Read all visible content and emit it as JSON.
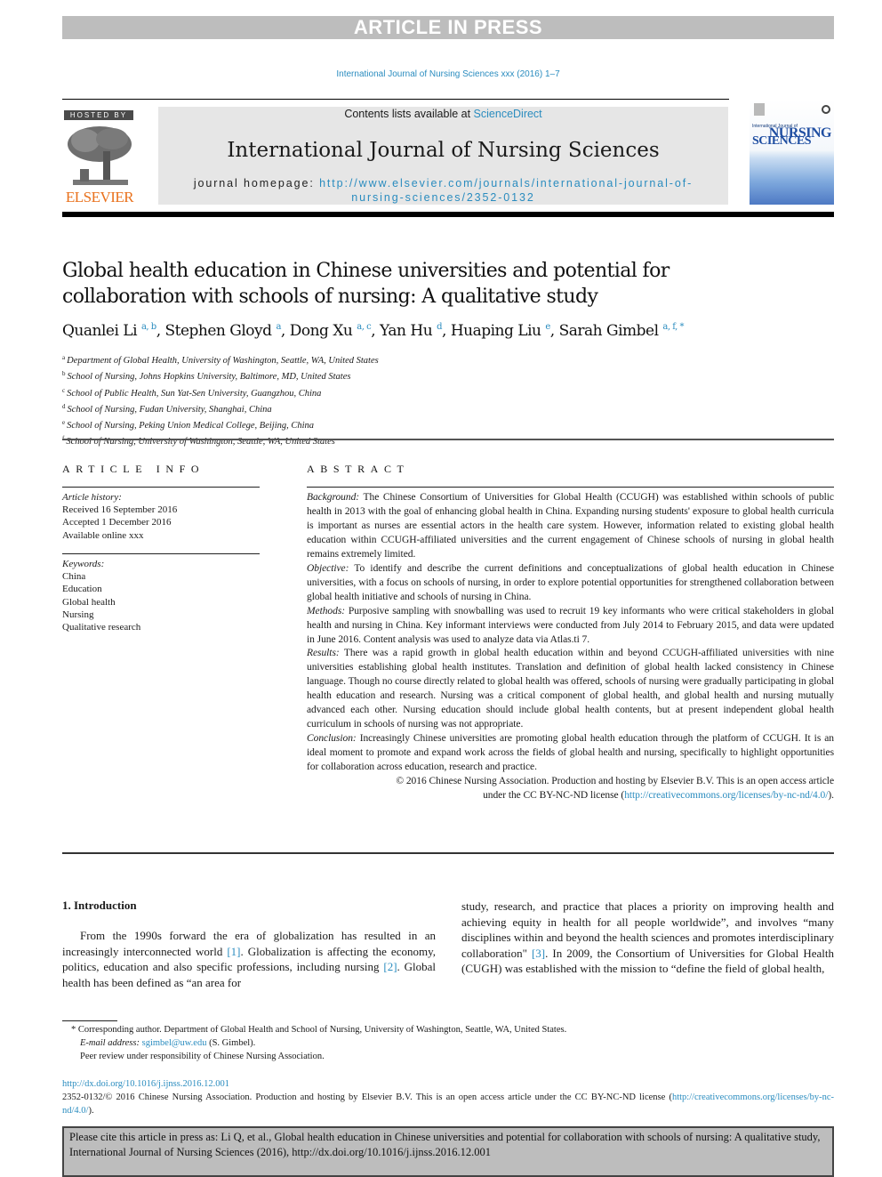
{
  "banner": {
    "text": "ARTICLE IN PRESS"
  },
  "running_head": "International Journal of Nursing Sciences xxx (2016) 1–7",
  "header": {
    "hosted_by": "HOSTED BY",
    "publisher": "ELSEVIER",
    "contents_prefix": "Contents lists available at ",
    "contents_link": "ScienceDirect",
    "journal_name": "International Journal of Nursing Sciences",
    "homepage_label": "journal homepage: ",
    "homepage_url_line1": "http://www.elsevier.com/journals/international-journal-of-",
    "homepage_url_line2": "nursing-sciences/2352-0132",
    "cover": {
      "small_title": "International Journal of",
      "word1": "NURSING",
      "word2": "SCIENCES"
    }
  },
  "article": {
    "title": "Global health education in Chinese universities and potential for collaboration with schools of nursing: A qualitative study",
    "authors": [
      {
        "name": "Quanlei Li",
        "sup": "a, b"
      },
      {
        "name": "Stephen Gloyd",
        "sup": "a"
      },
      {
        "name": "Dong Xu",
        "sup": "a, c"
      },
      {
        "name": "Yan Hu",
        "sup": "d"
      },
      {
        "name": "Huaping Liu",
        "sup": "e"
      },
      {
        "name": "Sarah Gimbel",
        "sup": "a, f, *"
      }
    ],
    "affiliations": [
      {
        "key": "a",
        "text": "Department of Global Health, University of Washington, Seattle, WA, United States"
      },
      {
        "key": "b",
        "text": "School of Nursing, Johns Hopkins University, Baltimore, MD, United States"
      },
      {
        "key": "c",
        "text": "School of Public Health, Sun Yat-Sen University, Guangzhou, China"
      },
      {
        "key": "d",
        "text": "School of Nursing, Fudan University, Shanghai, China"
      },
      {
        "key": "e",
        "text": "School of Nursing, Peking Union Medical College, Beijing, China"
      },
      {
        "key": "f",
        "text": "School of Nursing, University of Washington, Seattle, WA, United States"
      }
    ]
  },
  "article_info": {
    "heading": "ARTICLE INFO",
    "history_label": "Article history:",
    "history": [
      "Received 16 September 2016",
      "Accepted 1 December 2016",
      "Available online xxx"
    ],
    "keywords_label": "Keywords:",
    "keywords": [
      "China",
      "Education",
      "Global health",
      "Nursing",
      "Qualitative research"
    ]
  },
  "abstract": {
    "heading": "ABSTRACT",
    "sections": [
      {
        "label": "Background:",
        "text": "The Chinese Consortium of Universities for Global Health (CCUGH) was established within schools of public health in 2013 with the goal of enhancing global health in China. Expanding nursing students' exposure to global health curricula is important as nurses are essential actors in the health care system. However, information related to existing global health education within CCUGH-affiliated universities and the current engagement of Chinese schools of nursing in global health remains extremely limited."
      },
      {
        "label": "Objective:",
        "text": "To identify and describe the current definitions and conceptualizations of global health education in Chinese universities, with a focus on schools of nursing, in order to explore potential opportunities for strengthened collaboration between global health initiative and schools of nursing in China."
      },
      {
        "label": "Methods:",
        "text": "Purposive sampling with snowballing was used to recruit 19 key informants who were critical stakeholders in global health and nursing in China. Key informant interviews were conducted from July 2014 to February 2015, and data were updated in June 2016. Content analysis was used to analyze data via Atlas.ti 7."
      },
      {
        "label": "Results:",
        "text": "There was a rapid growth in global health education within and beyond CCUGH-affiliated universities with nine universities establishing global health institutes. Translation and definition of global health lacked consistency in Chinese language. Though no course directly related to global health was offered, schools of nursing were gradually participating in global health education and research. Nursing was a critical component of global health, and global health and nursing mutually advanced each other. Nursing education should include global health contents, but at present independent global health curriculum in schools of nursing was not appropriate."
      },
      {
        "label": "Conclusion:",
        "text": "Increasingly Chinese universities are promoting global health education through the platform of CCUGH. It is an ideal moment to promote and expand work across the fields of global health and nursing, specifically to highlight opportunities for collaboration across education, research and practice."
      }
    ],
    "copyright_line1": "© 2016 Chinese Nursing Association. Production and hosting by Elsevier B.V. This is an open access article",
    "copyright_line2_prefix": "under the CC BY-NC-ND license (",
    "copyright_link": "http://creativecommons.org/licenses/by-nc-nd/4.0/",
    "copyright_suffix": ")."
  },
  "introduction": {
    "heading": "1.  Introduction",
    "col1": [
      {
        "t": "From the 1990s forward the era of globalization has resulted in an increasingly interconnected world "
      },
      {
        "ref": "[1]"
      },
      {
        "t": ". Globalization is affecting the economy, politics, education and also specific professions, including nursing "
      },
      {
        "ref": "[2]"
      },
      {
        "t": ". Global health has been defined as “an area for"
      }
    ],
    "col2": [
      {
        "t": "study, research, and practice that places a priority on improving health and achieving equity in health for all people worldwide”, and involves “many disciplines within and beyond the health sciences and promotes interdisciplinary collaboration\" "
      },
      {
        "ref": "[3]"
      },
      {
        "t": ". In 2009, the Consortium of Universities for Global Health (CUGH) was established with the mission to “define the field of global health,"
      }
    ]
  },
  "footnotes": {
    "corresponding": "* Corresponding author. Department of Global Health and School of Nursing, University of Washington, Seattle, WA, United States.",
    "email_label": "E-mail address:",
    "email": "sgimbel@uw.edu",
    "email_suffix": " (S. Gimbel).",
    "peer_review": "Peer review under responsibility of Chinese Nursing Association."
  },
  "doi": {
    "url": "http://dx.doi.org/10.1016/j.ijnss.2016.12.001",
    "license_text": "2352-0132/© 2016 Chinese Nursing Association. Production and hosting by Elsevier B.V. This is an open access article under the CC BY-NC-ND license (",
    "license_link": "http://creativecommons.org/licenses/by-nc-nd/4.0/",
    "license_suffix": ")."
  },
  "cite_box": {
    "text": "Please cite this article in press as: Li Q, et al., Global health education in Chinese universities and potential for collaboration with schools of nursing: A qualitative study, International Journal of Nursing Sciences (2016), http://dx.doi.org/10.1016/j.ijnss.2016.12.001"
  },
  "colors": {
    "link": "#2a8cbf",
    "elsevier_orange": "#e9711c",
    "banner_gray": "#bdbdbd"
  }
}
